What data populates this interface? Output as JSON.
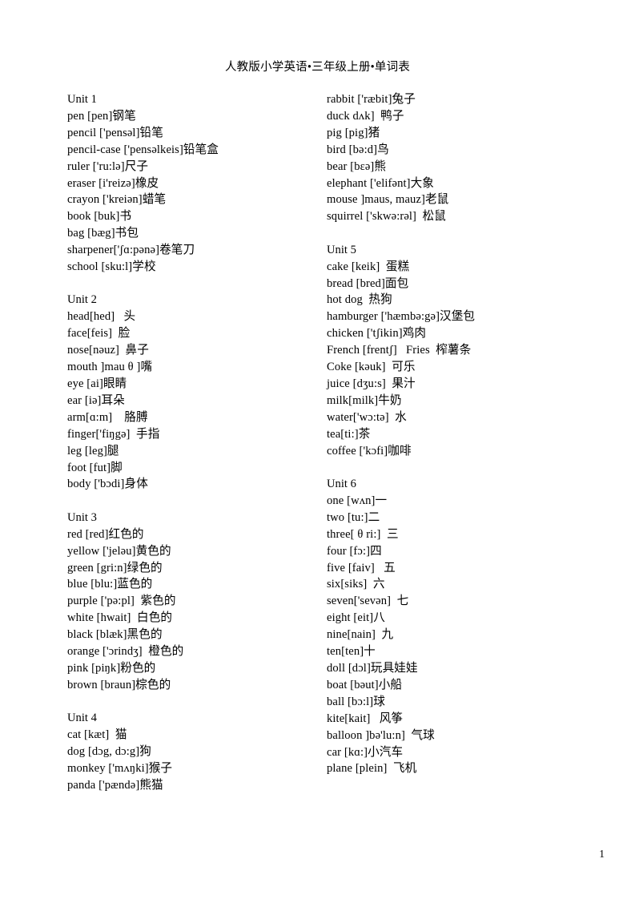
{
  "document": {
    "title": "人教版小学英语•三年级上册•单词表",
    "page_number": "1"
  },
  "left_column": {
    "blocks": [
      {
        "heading": "Unit 1",
        "entries": [
          "pen [pen]钢笔",
          "pencil ['pensəl]铅笔",
          "pencil-case ['pensəlkeis]铅笔盒",
          "ruler ['ru:lə]尺子",
          "eraser [i'reizə]橡皮",
          "crayon ['kreiən]蜡笔",
          "book [buk]书",
          "bag [bæg]书包",
          "sharpener['ʃɑ:pənə]卷笔刀",
          "school [sku:l]学校"
        ]
      },
      {
        "heading": "Unit 2",
        "entries": [
          "head[hed]   头",
          "face[feis]  脸",
          "nose[nəuz]  鼻子",
          "mouth ]mau θ ]嘴",
          "eye [ai]眼睛",
          "ear [iə]耳朵",
          "arm[ɑ:m]    胳膊",
          "finger['fiŋgə]  手指",
          "leg [leg]腿",
          "foot [fut]脚",
          "body ['bɔdi]身体"
        ]
      },
      {
        "heading": "Unit 3",
        "entries": [
          "red [red]红色的",
          "yellow ['jeləu]黄色的",
          "green [gri:n]绿色的",
          "blue [blu:]蓝色的",
          "purple ['pə:pl]  紫色的",
          "white [hwait]  白色的",
          "black [blæk]黑色的",
          "orange ['ɔrindʒ]  橙色的",
          "pink [piŋk]粉色的",
          "brown [braun]棕色的"
        ]
      },
      {
        "heading": "Unit 4",
        "entries": [
          "cat [kæt]  猫",
          "dog [dɔg, dɔ:g]狗",
          "monkey ['mʌŋki]猴子",
          "panda ['pændə]熊猫"
        ]
      }
    ]
  },
  "right_column": {
    "blocks": [
      {
        "heading": "",
        "entries": [
          "rabbit ['ræbit]兔子",
          "duck dʌk]  鸭子",
          "pig [pig]猪",
          "bird [bə:d]鸟",
          "bear [bɛə]熊",
          "elephant ['elifənt]大象",
          "mouse ]maus, mauz]老鼠",
          "squirrel ['skwə:rəl]  松鼠"
        ]
      },
      {
        "heading": "Unit 5",
        "entries": [
          "cake [keik]  蛋糕",
          "bread [bred]面包",
          "hot dog  热狗",
          "hamburger ['hæmbə:gə]汉堡包",
          "chicken ['tʃikin]鸡肉",
          "French [frentʃ]   Fries  榨薯条",
          "Coke [kəuk]  可乐",
          "juice [dʒu:s]  果汁",
          "milk[milk]牛奶",
          "water['wɔ:tə]  水",
          "tea[ti:]茶",
          "coffee ['kɔfi]咖啡"
        ]
      },
      {
        "heading": "Unit 6",
        "entries": [
          "one [wʌn]一",
          "two [tu:]二",
          "three[ θ ri:]  三",
          "four [fɔ:]四",
          "five [faiv]   五",
          "six[siks]  六",
          "seven['sevən]  七",
          "eight [eit]八",
          "nine[nain]  九",
          "ten[ten]十",
          "doll [dɔl]玩具娃娃",
          "boat [bəut]小船",
          "ball [bɔ:l]球",
          "kite[kait]   风筝",
          "balloon ]bə'lu:n]  气球",
          "car [kɑ:]小汽车",
          "plane [plein]  飞机"
        ]
      }
    ]
  }
}
